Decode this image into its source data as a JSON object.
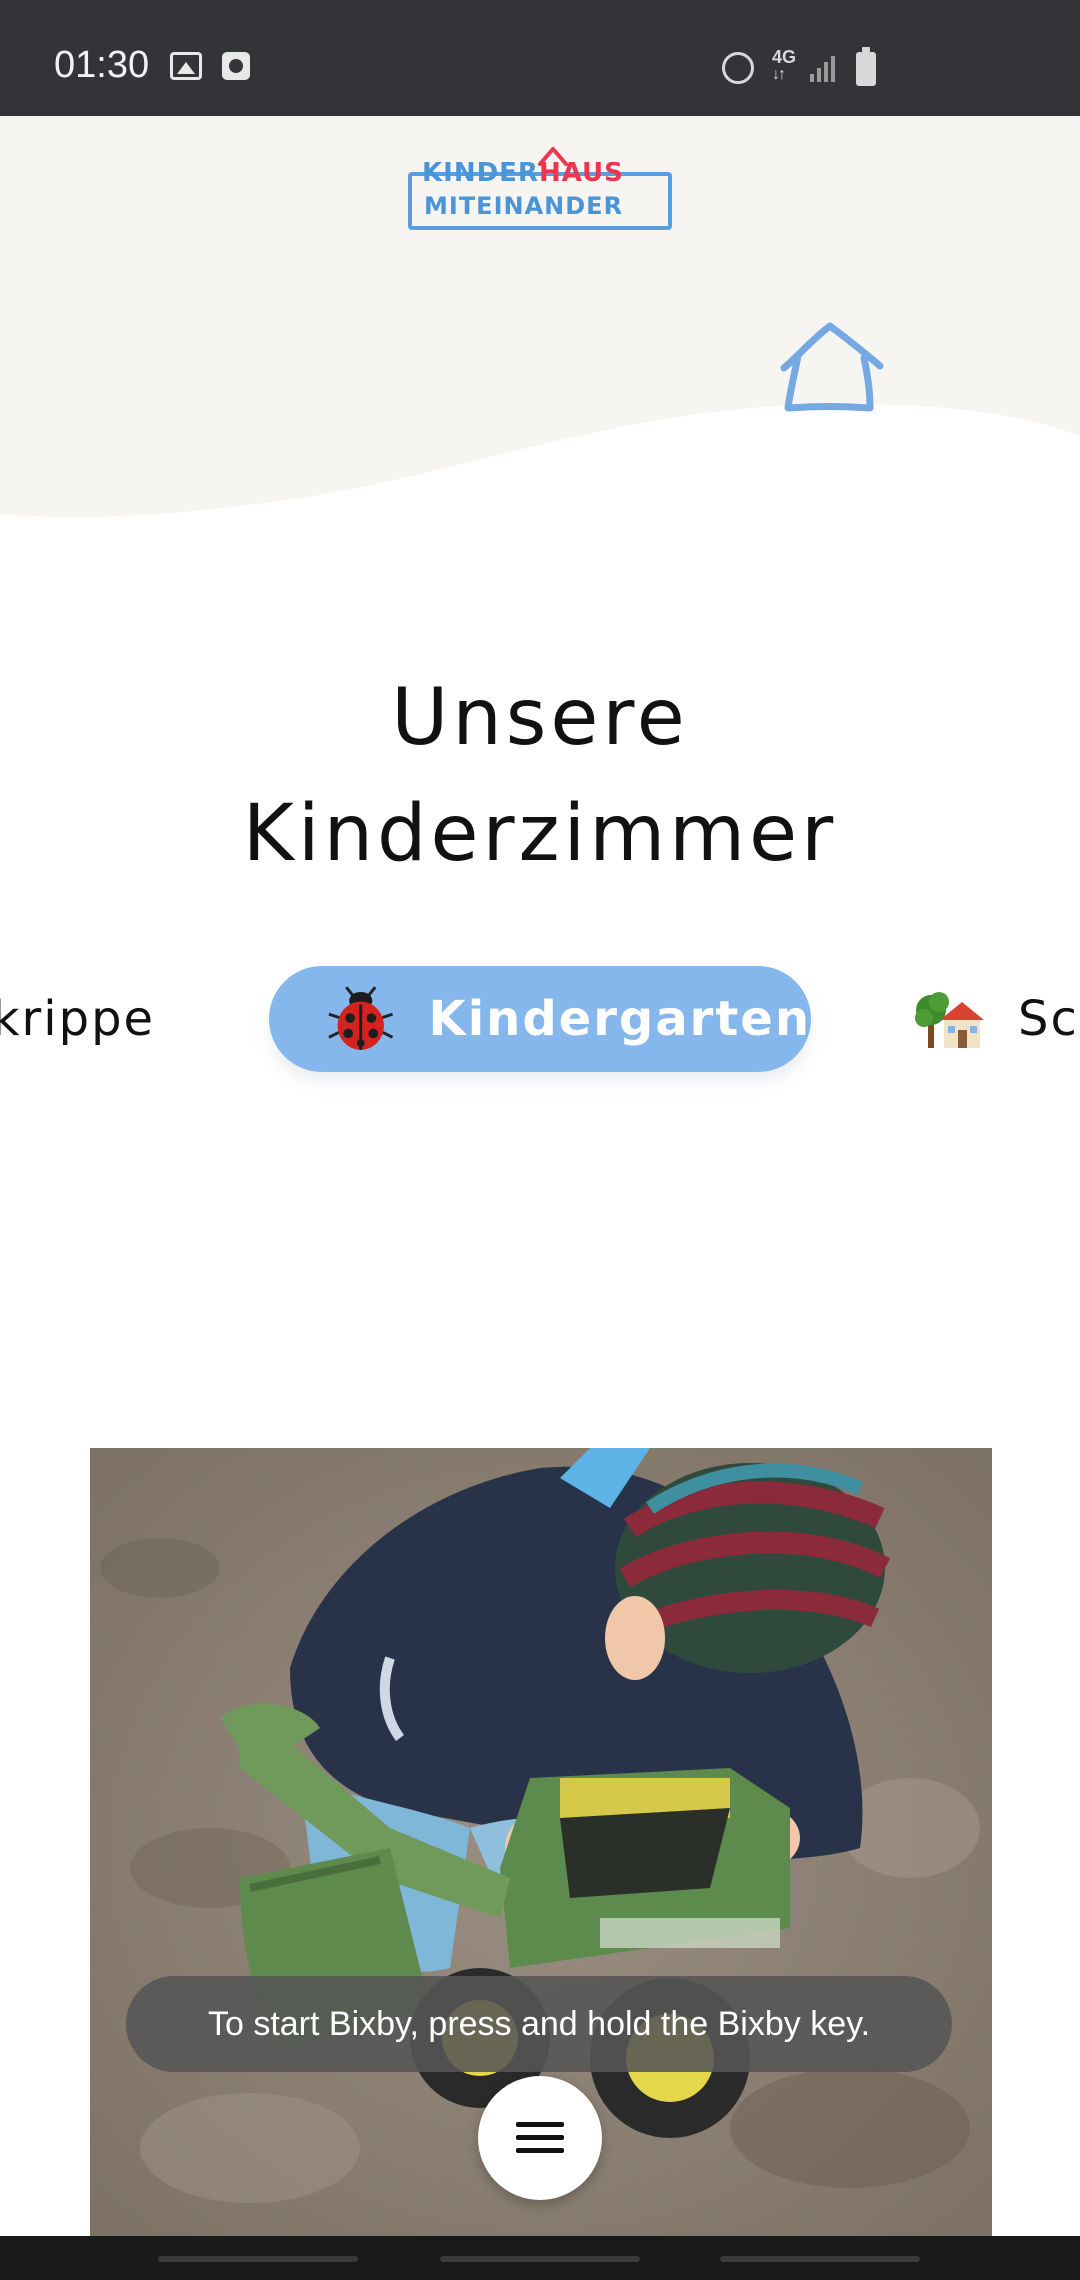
{
  "status_bar": {
    "time": "01:30",
    "network": "4G",
    "network_arrows": "↓↑",
    "icons": [
      "gallery-icon",
      "clock-app-icon",
      "alarm-icon",
      "signal-icon",
      "battery-icon"
    ]
  },
  "header": {
    "logo_line1_part1": "KINDER",
    "logo_line1_part2": "HAUS",
    "logo_line2": "MITEINANDER",
    "home_icon": "home-icon"
  },
  "main": {
    "title_line1": "Unsere",
    "title_line2": "Kinderzimmer"
  },
  "tabs": [
    {
      "label": "rkrippe",
      "icon": "",
      "active": false
    },
    {
      "label": "Kindergarten",
      "icon": "ladybug-icon",
      "active": true
    },
    {
      "label": "Sc",
      "icon": "house-with-tree-icon",
      "active": false
    }
  ],
  "photo": {
    "icon": "child-playing-with-toy-excavator-photo"
  },
  "toast": {
    "message": "To start Bixby, press and hold the Bixby key."
  },
  "menu": {
    "icon": "hamburger-menu-icon"
  },
  "colors": {
    "accent_blue": "#86b7ec",
    "logo_blue": "#4a94d8",
    "logo_red": "#e8374f",
    "header_beige": "#f7f5f1",
    "status_bar": "#333438"
  }
}
